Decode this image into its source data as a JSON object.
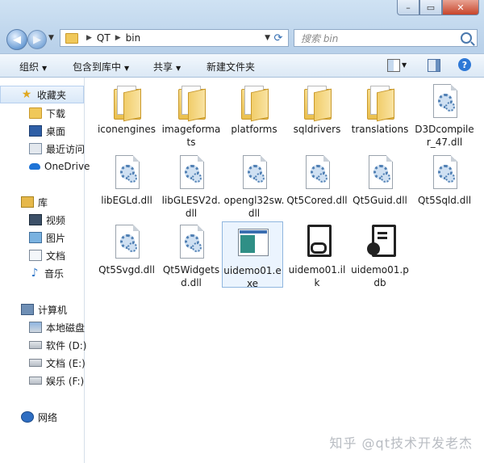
{
  "address": {
    "crumbs": [
      "QT",
      "bin"
    ],
    "search_placeholder": "搜索 bin"
  },
  "toolbar": {
    "organize": "组织",
    "include_in_library": "包含到库中",
    "share": "共享",
    "new_folder": "新建文件夹"
  },
  "nav": {
    "favorites": "收藏夹",
    "downloads": "下载",
    "desktop": "桌面",
    "recent": "最近访问",
    "onedrive": "OneDrive",
    "libraries": "库",
    "videos": "视频",
    "pictures": "图片",
    "documents": "文档",
    "music": "音乐",
    "computer": "计算机",
    "local_disk": "本地磁盘",
    "drive_d": "软件 (D:)",
    "drive_e": "文档 (E:)",
    "drive_f": "娱乐 (F:)",
    "network": "网络"
  },
  "files": [
    {
      "name": "iconengines",
      "type": "folder-icon"
    },
    {
      "name": "imageformats",
      "type": "folder-icon"
    },
    {
      "name": "platforms",
      "type": "folder-icon"
    },
    {
      "name": "sqldrivers",
      "type": "folder-icon"
    },
    {
      "name": "translations",
      "type": "folder-icon"
    },
    {
      "name": "D3Dcompiler_47.dll",
      "type": "dll-icon"
    },
    {
      "name": "libEGLd.dll",
      "type": "dll-icon"
    },
    {
      "name": "libGLESV2d.dll",
      "type": "dll-icon"
    },
    {
      "name": "opengl32sw.dll",
      "type": "dll-icon"
    },
    {
      "name": "Qt5Cored.dll",
      "type": "dll-icon"
    },
    {
      "name": "Qt5Guid.dll",
      "type": "dll-icon"
    },
    {
      "name": "Qt5Sqld.dll",
      "type": "dll-icon"
    },
    {
      "name": "Qt5Svgd.dll",
      "type": "dll-icon"
    },
    {
      "name": "Qt5Widgetsd.dll",
      "type": "dll-icon"
    },
    {
      "name": "uidemo01.exe",
      "type": "exe-icon",
      "selected": true
    },
    {
      "name": "uidemo01.ilk",
      "type": "ilk-icon"
    },
    {
      "name": "uidemo01.pdb",
      "type": "pdb-icon"
    }
  ],
  "watermark": "知乎 @qt技术开发老杰"
}
